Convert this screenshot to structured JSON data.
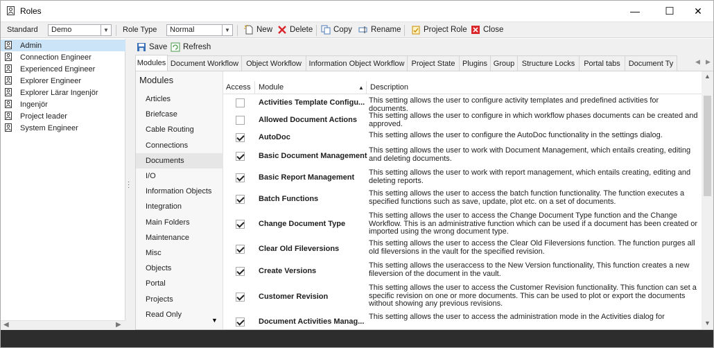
{
  "window": {
    "title": "Roles",
    "minimize": "—",
    "maximize": "☐",
    "close": "✕"
  },
  "toolbar": {
    "standard_label": "Standard",
    "standard_value": "Demo",
    "role_type_label": "Role Type",
    "role_type_value": "Normal",
    "new": "New",
    "delete": "Delete",
    "copy": "Copy",
    "rename": "Rename",
    "project_role": "Project Role",
    "close": "Close"
  },
  "roles": [
    "Admin",
    "Connection Engineer",
    "Experienced Engineer",
    "Explorer Engineer",
    "Explorer Lärar Ingenjör",
    "Ingenjör",
    "Project leader",
    "System Engineer"
  ],
  "actions": {
    "save": "Save",
    "refresh": "Refresh"
  },
  "tabs": [
    "Modules",
    "Document Workflow",
    "Object Workflow",
    "Information Object Workflow",
    "Project State",
    "Plugins",
    "Group",
    "Structure Locks",
    "Portal tabs",
    "Document Ty"
  ],
  "modules_heading": "Modules",
  "modules": [
    "Articles",
    "Briefcase",
    "Cable Routing",
    "Connections",
    "Documents",
    "I/O",
    "Information Objects",
    "Integration",
    "Main Folders",
    "Maintenance",
    "Misc",
    "Objects",
    "Portal",
    "Projects",
    "Read Only"
  ],
  "grid": {
    "col_access": "Access",
    "col_module": "Module",
    "col_description": "Description",
    "rows": [
      {
        "name": "Activities Template Configu...",
        "checked": false,
        "desc": "This setting allows the user to configure activity templates and predefined activities for documents."
      },
      {
        "name": "Allowed Document Actions",
        "checked": false,
        "desc": "This setting allows the user to configure in which workflow phases documents can be created and approved."
      },
      {
        "name": "AutoDoc",
        "checked": true,
        "desc": "This setting allows the user to configure the AutoDoc functionality in the settings dialog."
      },
      {
        "name": "Basic Document Management",
        "checked": true,
        "desc": "This setting allows the user to work with Document Management, which entails creating, editing and deleting documents."
      },
      {
        "name": "Basic Report Management",
        "checked": true,
        "desc": "This setting allows the user to work with report management, which entails creating, editing and deleting reports."
      },
      {
        "name": "Batch Functions",
        "checked": true,
        "desc": "This setting allows the user to access the batch function functionality. The function executes a specified functions such as save, update, plot etc. on a set of documents."
      },
      {
        "name": "Change Document Type",
        "checked": true,
        "desc": "This setting allows the user to access the Change Document Type function and the Change Workflow. This is an administrative function which can be used if a document has been created or imported using the wrong document type."
      },
      {
        "name": "Clear Old Fileversions",
        "checked": true,
        "desc": "This setting allows the user to access the Clear Old Fileversions function. The function purges all old fileversions in the vault for the specified revision."
      },
      {
        "name": "Create Versions",
        "checked": true,
        "desc": "This setting allows the useraccess to the New Version functionality, This function creates a new fileversion of the document in the vault."
      },
      {
        "name": "Customer Revision",
        "checked": true,
        "desc": "This setting allows the user to access the Customer Revision functionality. This function can set a specific revision on one or more documents. This can be used to plot or export the documents without showing any previous revisions."
      },
      {
        "name": "Document Activities Manag...",
        "checked": true,
        "desc": "This setting allows the user to access the administration mode in the Activities dialog for"
      }
    ]
  }
}
